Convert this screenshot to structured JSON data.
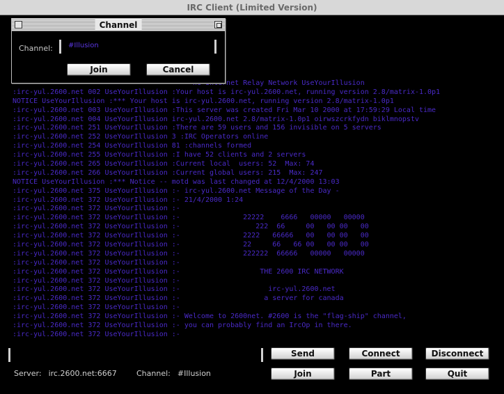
{
  "window": {
    "title": "IRC Client (Limited Version)"
  },
  "channel_dialog": {
    "title": "Channel",
    "label": "Channel:",
    "value": "#Illusion",
    "join_label": "Join",
    "cancel_label": "Cancel"
  },
  "chat_lines": [
    "                                           he Internet Relay Network UseYourIllusion",
    ":irc-yul.2600.net 002 UseYourIllusion :Your host is irc-yul.2600.net, running version 2.8/matrix-1.0p1",
    "NOTICE UseYourIllusion :*** Your host is irc-yul.2600.net, running version 2.8/matrix-1.0p1",
    ":irc-yul.2600.net 003 UseYourIllusion :This server was created Fri Mar 10 2000 at 17:59:29 Local time",
    ":irc-yul.2600.net 004 UseYourIllusion irc-yul.2600.net 2.8/matrix-1.0p1 oirwszcrkfydn biklmnopstv",
    ":irc-yul.2600.net 251 UseYourIllusion :There are 59 users and 156 invisible on 5 servers",
    ":irc-yul.2600.net 252 UseYourIllusion 3 :IRC Operators online",
    ":irc-yul.2600.net 254 UseYourIllusion 81 :channels formed",
    ":irc-yul.2600.net 255 UseYourIllusion :I have 52 clients and 2 servers",
    ":irc-yul.2600.net 265 UseYourIllusion :Current local  users: 52  Max: 74",
    ":irc-yul.2600.net 266 UseYourIllusion :Current global users: 215  Max: 247",
    "NOTICE UseYourIllusion :*** Notice -- motd was last changed at 12/4/2000 13:03",
    ":irc-yul.2600.net 375 UseYourIllusion :- irc-yul.2600.net Message of the Day -",
    ":irc-yul.2600.net 372 UseYourIllusion :- 21/4/2000 1:24",
    ":irc-yul.2600.net 372 UseYourIllusion :-",
    ":irc-yul.2600.net 372 UseYourIllusion :-               22222    6666   00000   00000",
    ":irc-yul.2600.net 372 UseYourIllusion :-                  222  66     00   00 00   00",
    ":irc-yul.2600.net 372 UseYourIllusion :-               2222   66666   00   00 00   00",
    ":irc-yul.2600.net 372 UseYourIllusion :-               22     66   66 00   00 00   00",
    ":irc-yul.2600.net 372 UseYourIllusion :-               222222  66666   00000   00000",
    ":irc-yul.2600.net 372 UseYourIllusion :-",
    ":irc-yul.2600.net 372 UseYourIllusion :-                   THE 2600 IRC NETWORK",
    ":irc-yul.2600.net 372 UseYourIllusion :-",
    ":irc-yul.2600.net 372 UseYourIllusion :-                     irc-yul.2600.net",
    ":irc-yul.2600.net 372 UseYourIllusion :-                    a server for canada",
    ":irc-yul.2600.net 372 UseYourIllusion :-",
    ":irc-yul.2600.net 372 UseYourIllusion :- Welcome to 2600net. #2600 is the \"flag-ship\" channel,",
    ":irc-yul.2600.net 372 UseYourIllusion :- you can probably find an IrcOp in there.",
    ":irc-yul.2600.net 372 UseYourIllusion :-"
  ],
  "message_input": {
    "value": ""
  },
  "buttons": {
    "send": "Send",
    "connect": "Connect",
    "disconnect": "Disconnect",
    "join": "Join",
    "part": "Part",
    "quit": "Quit"
  },
  "status": {
    "server_label": "Server:",
    "server_value": "irc.2600.net:6667",
    "channel_label": "Channel:",
    "channel_value": "#Illusion"
  },
  "colors": {
    "background": "#000000",
    "chat_text": "#4a2ac8",
    "status_text": "#cfcfcf"
  }
}
